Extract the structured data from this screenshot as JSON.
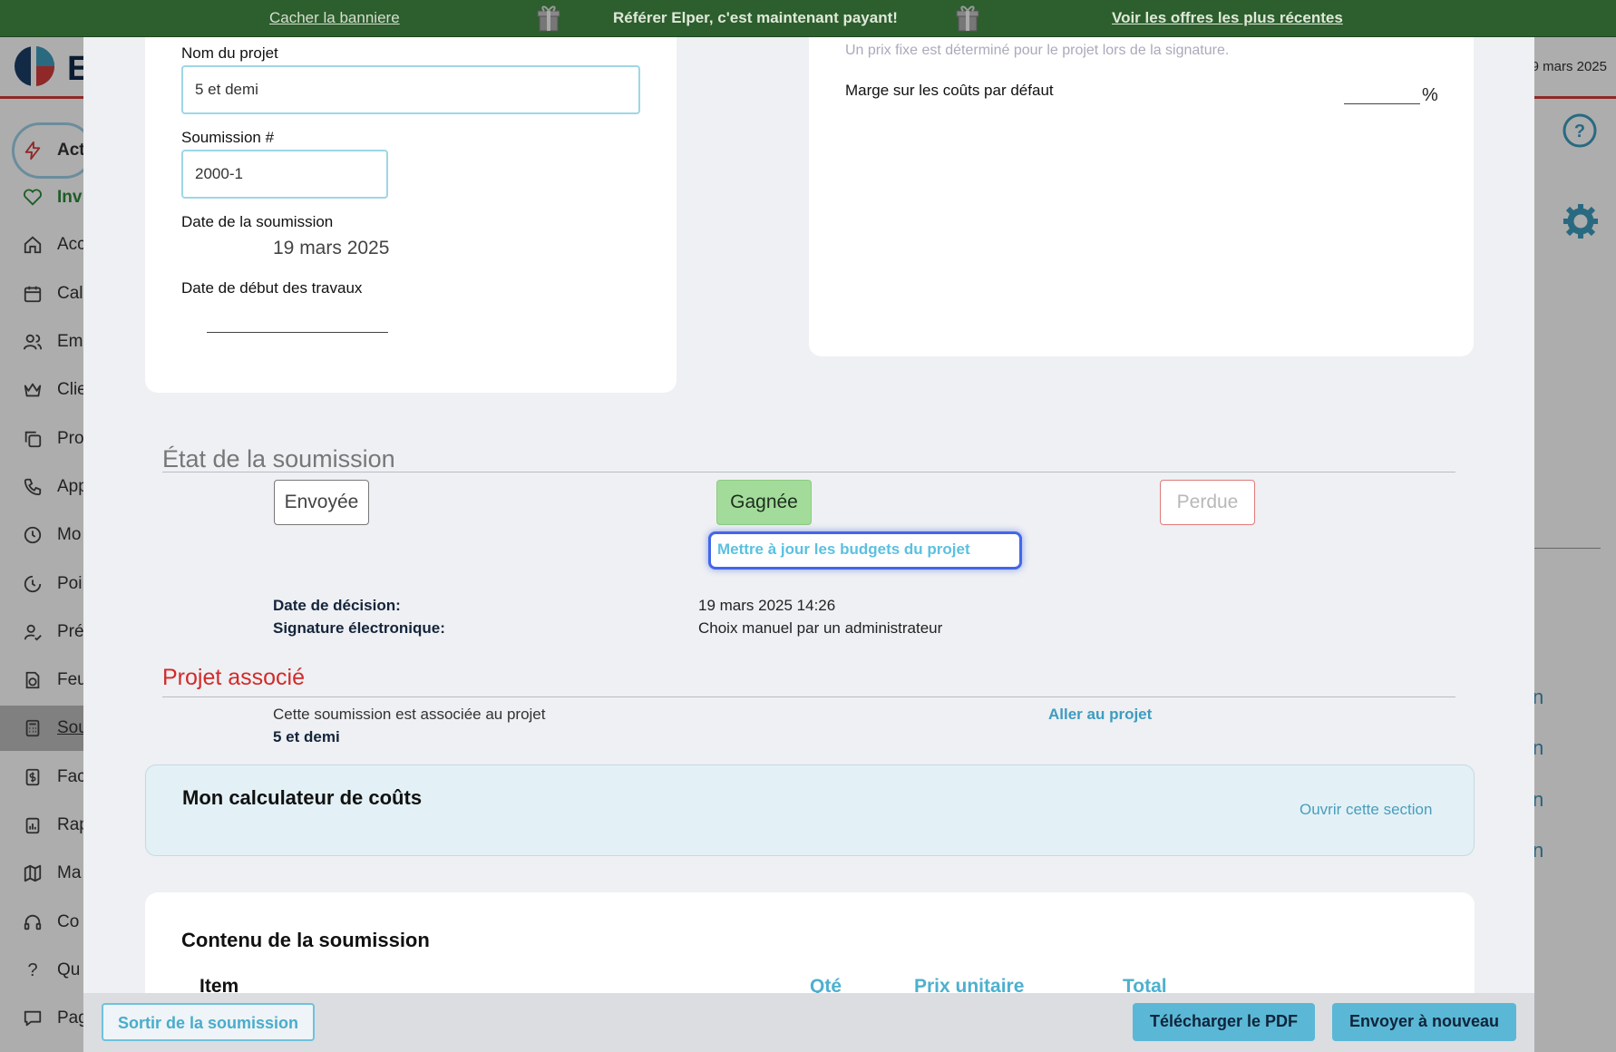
{
  "banner": {
    "hide_label": "Cacher la banniere",
    "message": "Référer Elper, c'est maintenant payant!",
    "offers_label": "Voir les offres les plus récentes",
    "bg_color": "#2d5e2e"
  },
  "app": {
    "logo_letter": "E",
    "date_partial": "9 mars 2025",
    "sidebar": [
      {
        "label": "Act",
        "icon": "bolt-icon"
      },
      {
        "label": "Inv",
        "icon": "handshake-heart-icon"
      },
      {
        "label": "Acc",
        "icon": "home-icon"
      },
      {
        "label": "Cal",
        "icon": "calendar-icon"
      },
      {
        "label": "Em",
        "icon": "users-icon"
      },
      {
        "label": "Clie",
        "icon": "crown-icon"
      },
      {
        "label": "Pro",
        "icon": "copy-icon"
      },
      {
        "label": "App",
        "icon": "phone-icon"
      },
      {
        "label": "Mo",
        "icon": "clock-check-icon"
      },
      {
        "label": "Poi",
        "icon": "clock-arrow-icon"
      },
      {
        "label": "Pré",
        "icon": "user-check-icon"
      },
      {
        "label": "Feu",
        "icon": "document-clock-icon"
      },
      {
        "label": "Sou",
        "icon": "calculator-icon"
      },
      {
        "label": "Fac",
        "icon": "invoice-dollar-icon"
      },
      {
        "label": "Rap",
        "icon": "clipboard-chart-icon"
      },
      {
        "label": "Ma",
        "icon": "map-icon"
      },
      {
        "label": "Co",
        "icon": "headset-icon"
      },
      {
        "label": "Qu",
        "icon": "question-icon"
      },
      {
        "label": "Pag",
        "icon": "chat-icon"
      }
    ],
    "right_chars": [
      "n",
      "n",
      "n",
      "n"
    ]
  },
  "form": {
    "project_name_label": "Nom du projet",
    "project_name_value": "5 et demi",
    "quote_number_label": "Soumission #",
    "quote_number_value": "2000-1",
    "quote_date_label": "Date de la soumission",
    "quote_date_value": "19 mars 2025",
    "start_date_label": "Date de début des travaux",
    "fixed_price_note": "Un prix fixe est déterminé pour le projet lors de la signature.",
    "margin_label": "Marge sur les coûts par défaut",
    "margin_unit": "%"
  },
  "status": {
    "title": "État de la soumission",
    "sent_label": "Envoyée",
    "won_label": "Gagnée",
    "lost_label": "Perdue",
    "update_budgets_label": "Mettre à jour les budgets du projet",
    "decision_date_label": "Date de décision:",
    "decision_date_value": "19 mars 2025 14:26",
    "signature_label": "Signature électronique:",
    "signature_value": "Choix manuel par un administrateur"
  },
  "associated": {
    "title": "Projet associé",
    "text": "Cette soumission est associée au projet",
    "project_name": "5 et demi",
    "go_to_project": "Aller au projet"
  },
  "calculator": {
    "title": "Mon calculateur de coûts",
    "open_label": "Ouvrir cette section"
  },
  "content": {
    "title": "Contenu de la soumission",
    "columns": [
      "Item",
      "Qté",
      "Prix unitaire",
      "Total"
    ]
  },
  "footer": {
    "exit_label": "Sortir de la soumission",
    "download_label": "Télécharger le PDF",
    "resend_label": "Envoyer à nouveau"
  },
  "colors": {
    "accent": "#4db0cf",
    "won_bg": "#a3dc9a",
    "lost": "#e07a7a",
    "associated_red": "#d32a2a",
    "calculator_bg": "#e3f1f7"
  }
}
